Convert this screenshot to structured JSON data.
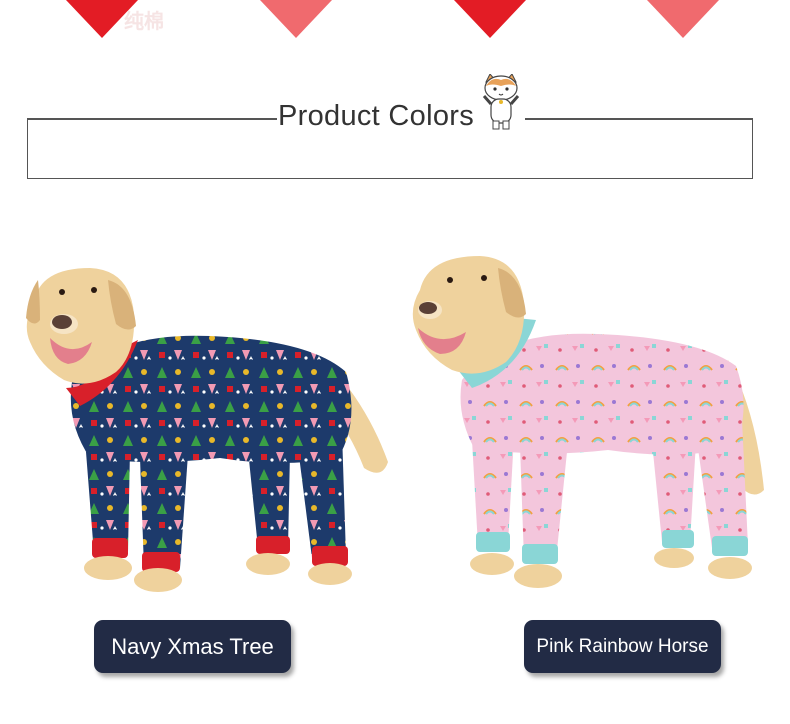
{
  "section": {
    "title": "Product Colors"
  },
  "decor": {
    "watermark": "纯棉"
  },
  "products": [
    {
      "label": "Navy Xmas Tree",
      "suit_color": "#1d3a6b",
      "trim_color": "#d8202a"
    },
    {
      "label": "Pink Rainbow Horse",
      "suit_color": "#f3c6dc",
      "trim_color": "#8ad6d6"
    }
  ],
  "colors": {
    "heart": "#e31c25",
    "button_bg": "#222b45",
    "dog_fur": "#efd29d"
  }
}
